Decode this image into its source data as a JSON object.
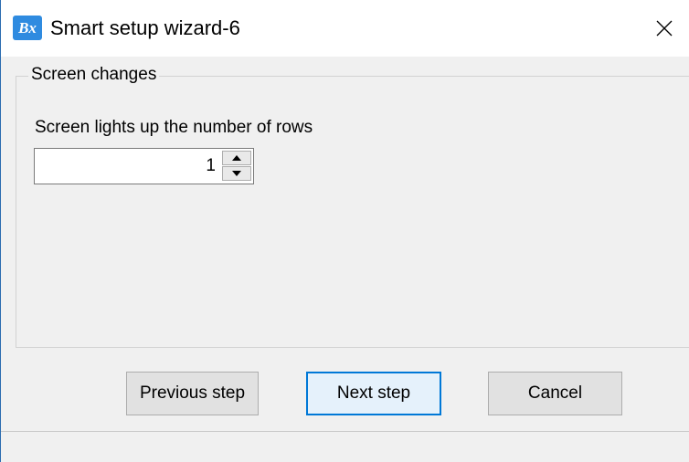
{
  "window": {
    "title": "Smart setup wizard-6",
    "app_icon_text": "Bx",
    "close_icon": "close-icon"
  },
  "group": {
    "title": "Screen changes"
  },
  "rows_field": {
    "label": "Screen lights up the number of rows",
    "value": "1"
  },
  "buttons": {
    "previous": "Previous step",
    "next": "Next step",
    "cancel": "Cancel"
  },
  "colors": {
    "accent": "#0078d7",
    "app_icon": "#2f8be0",
    "background": "#f0f0f0"
  }
}
